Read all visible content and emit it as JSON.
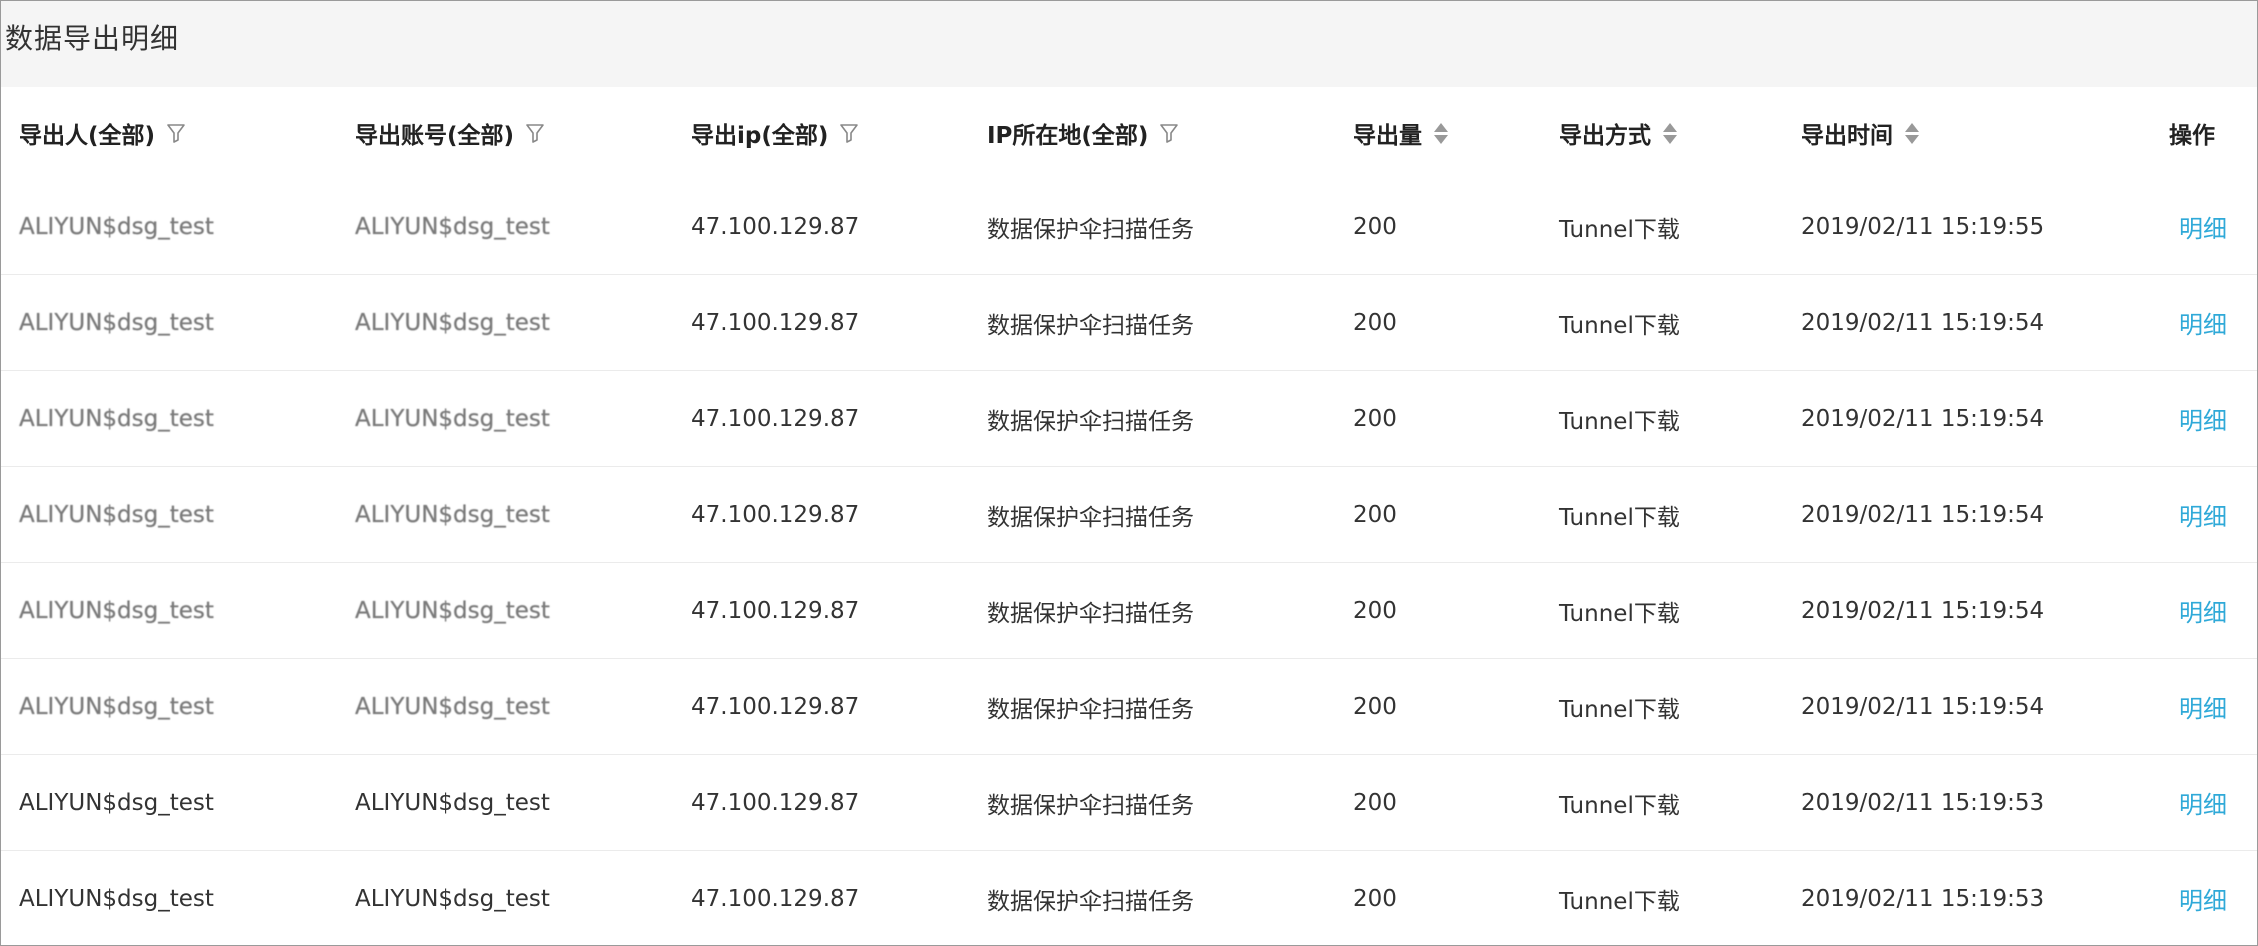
{
  "page": {
    "title": "数据导出明细",
    "link_color": "#2fa9d8"
  },
  "table": {
    "columns": [
      {
        "label": "导出人(全部)",
        "icon": "filter-icon"
      },
      {
        "label": "导出账号(全部)",
        "icon": "filter-icon"
      },
      {
        "label": "导出ip(全部)",
        "icon": "filter-icon"
      },
      {
        "label": "IP所在地(全部)",
        "icon": "filter-icon"
      },
      {
        "label": "导出量",
        "icon": "sort-icon"
      },
      {
        "label": "导出方式",
        "icon": "sort-icon"
      },
      {
        "label": "导出时间",
        "icon": "sort-icon"
      },
      {
        "label": "操作",
        "icon": ""
      }
    ],
    "rows": [
      {
        "exporter": "ALIYUN$dsg_test",
        "account": "ALIYUN$dsg_test",
        "ip": "47.100.129.87",
        "location": "数据保护伞扫描任务",
        "amount": "200",
        "method": "Tunnel下载",
        "time": "2019/02/11 15:19:55",
        "action": "明细",
        "blurred": true
      },
      {
        "exporter": "ALIYUN$dsg_test",
        "account": "ALIYUN$dsg_test",
        "ip": "47.100.129.87",
        "location": "数据保护伞扫描任务",
        "amount": "200",
        "method": "Tunnel下载",
        "time": "2019/02/11 15:19:54",
        "action": "明细",
        "blurred": true
      },
      {
        "exporter": "ALIYUN$dsg_test",
        "account": "ALIYUN$dsg_test",
        "ip": "47.100.129.87",
        "location": "数据保护伞扫描任务",
        "amount": "200",
        "method": "Tunnel下载",
        "time": "2019/02/11 15:19:54",
        "action": "明细",
        "blurred": true
      },
      {
        "exporter": "ALIYUN$dsg_test",
        "account": "ALIYUN$dsg_test",
        "ip": "47.100.129.87",
        "location": "数据保护伞扫描任务",
        "amount": "200",
        "method": "Tunnel下载",
        "time": "2019/02/11 15:19:54",
        "action": "明细",
        "blurred": true
      },
      {
        "exporter": "ALIYUN$dsg_test",
        "account": "ALIYUN$dsg_test",
        "ip": "47.100.129.87",
        "location": "数据保护伞扫描任务",
        "amount": "200",
        "method": "Tunnel下载",
        "time": "2019/02/11 15:19:54",
        "action": "明细",
        "blurred": true
      },
      {
        "exporter": "ALIYUN$dsg_test",
        "account": "ALIYUN$dsg_test",
        "ip": "47.100.129.87",
        "location": "数据保护伞扫描任务",
        "amount": "200",
        "method": "Tunnel下载",
        "time": "2019/02/11 15:19:54",
        "action": "明细",
        "blurred": true
      },
      {
        "exporter": "ALIYUN$dsg_test",
        "account": "ALIYUN$dsg_test",
        "ip": "47.100.129.87",
        "location": "数据保护伞扫描任务",
        "amount": "200",
        "method": "Tunnel下载",
        "time": "2019/02/11 15:19:53",
        "action": "明细",
        "blurred": false
      },
      {
        "exporter": "ALIYUN$dsg_test",
        "account": "ALIYUN$dsg_test",
        "ip": "47.100.129.87",
        "location": "数据保护伞扫描任务",
        "amount": "200",
        "method": "Tunnel下载",
        "time": "2019/02/11 15:19:53",
        "action": "明细",
        "blurred": false
      }
    ]
  }
}
